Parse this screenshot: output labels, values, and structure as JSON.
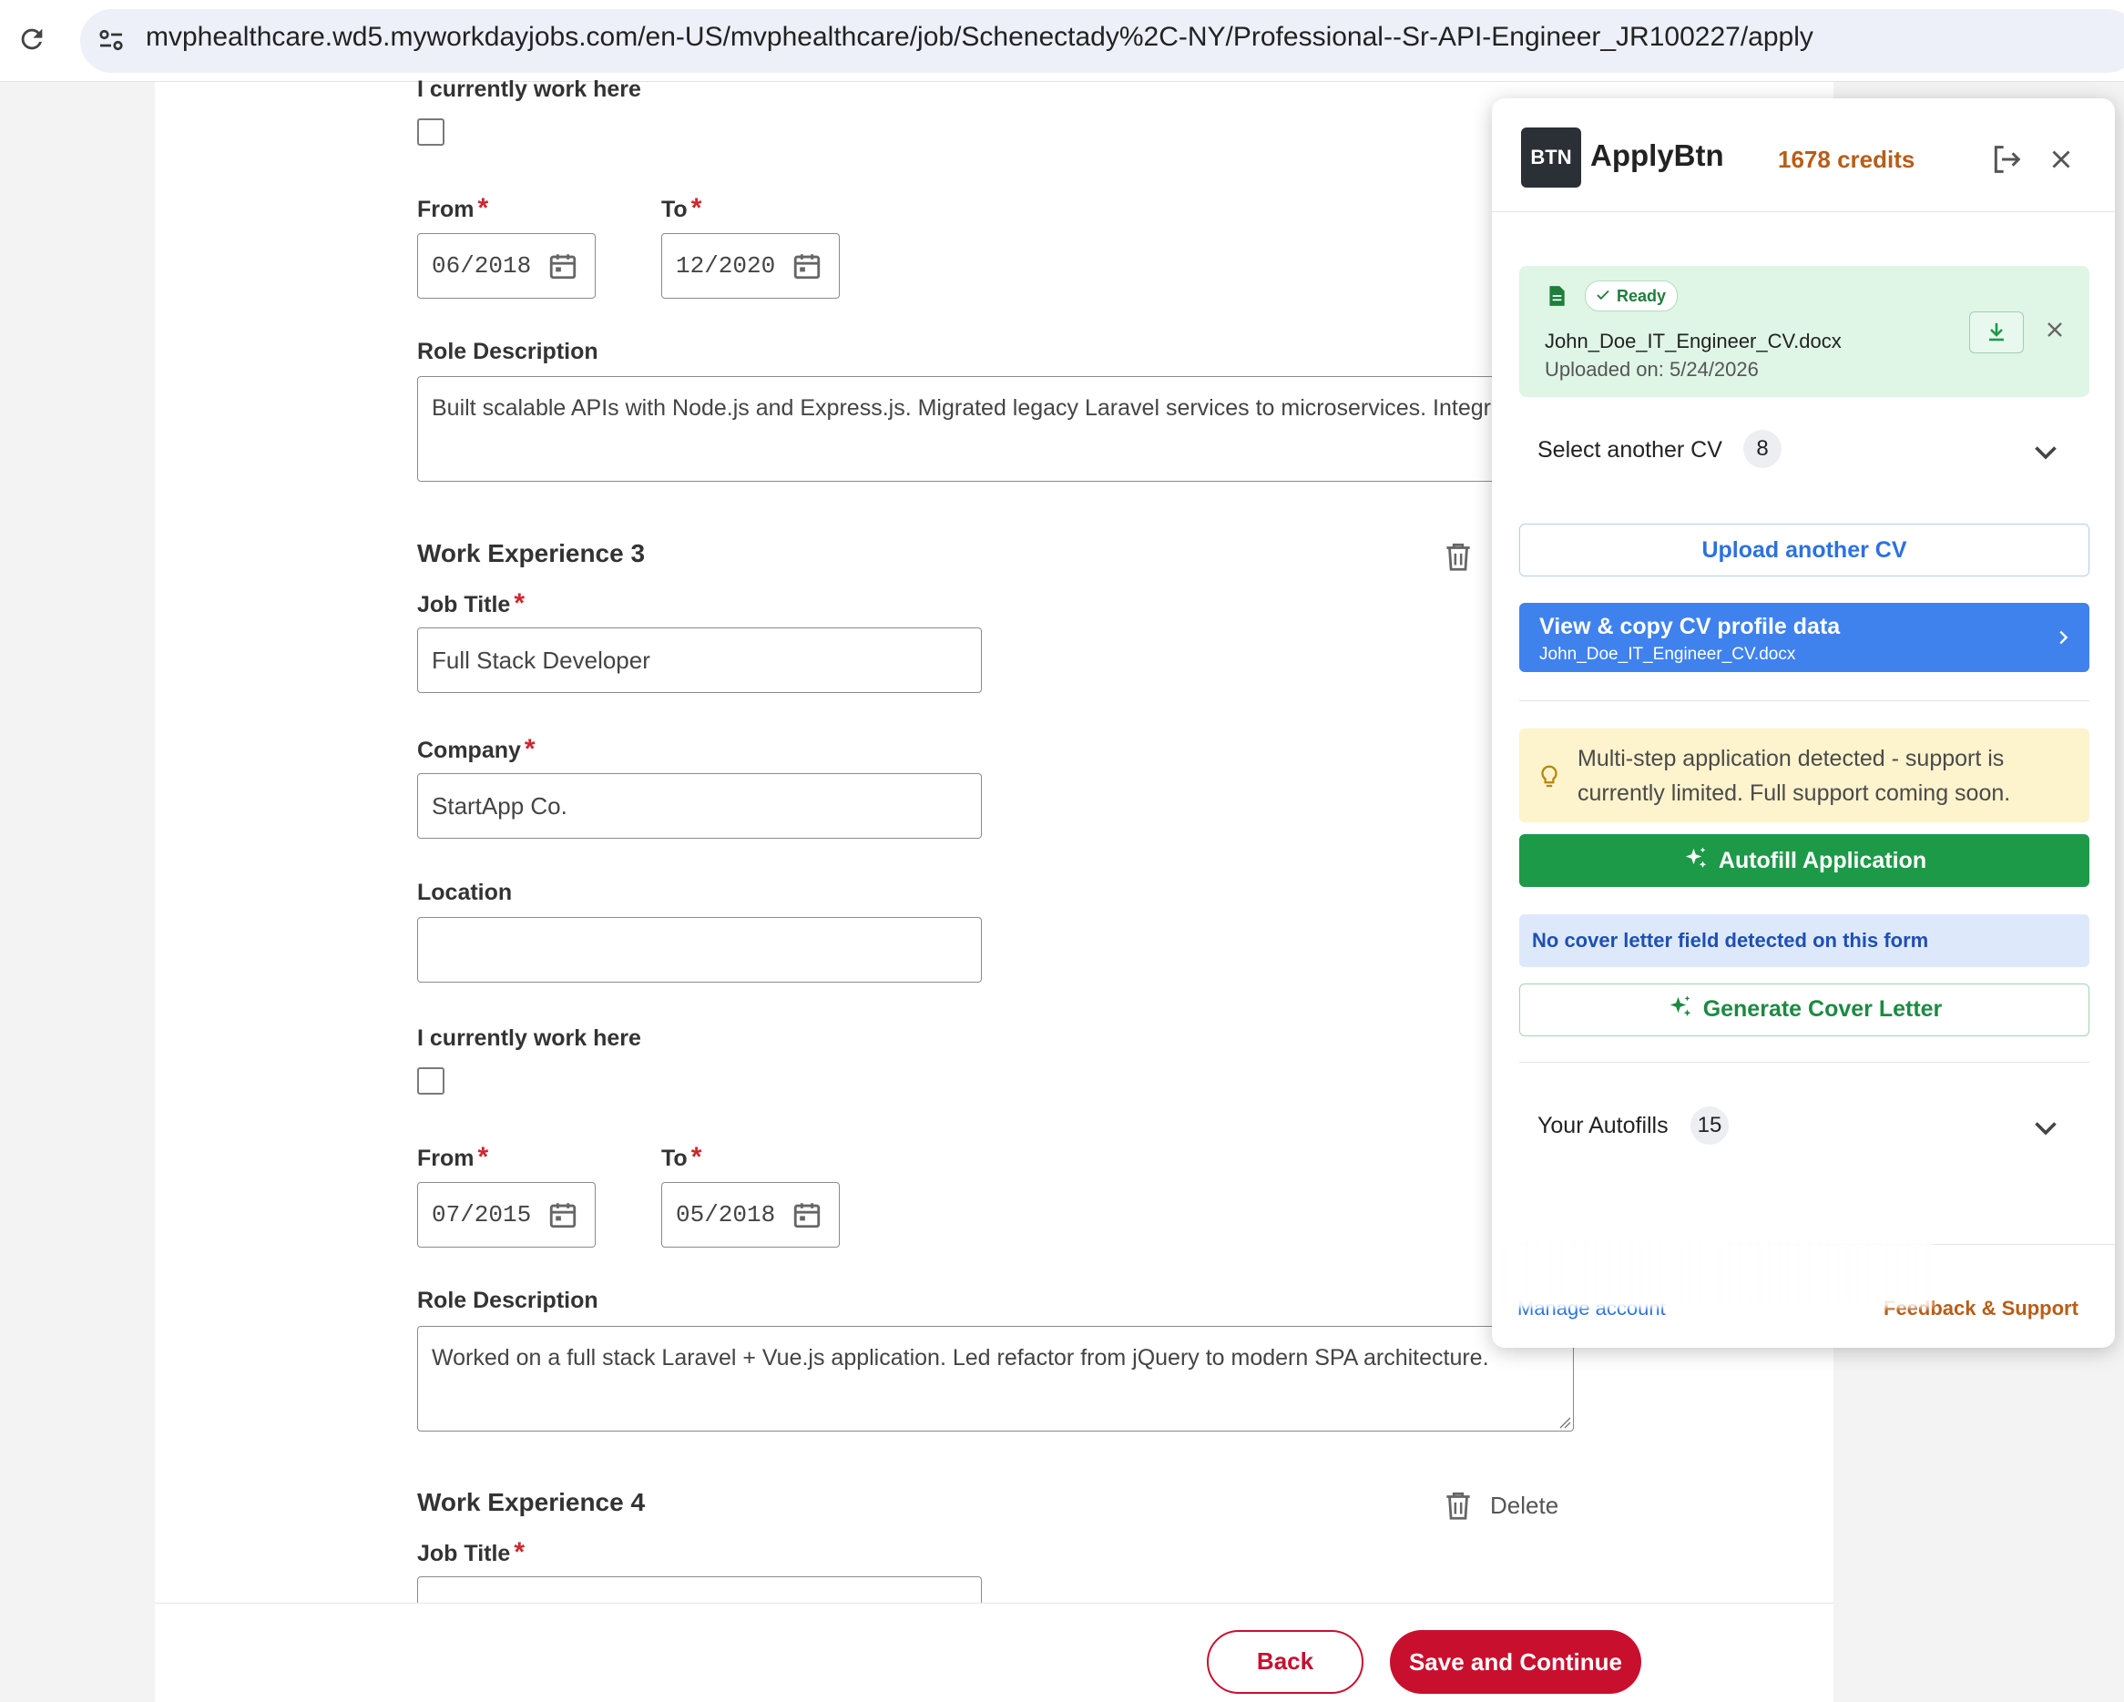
{
  "browser": {
    "url": "mvphealthcare.wd5.myworkdayjobs.com/en-US/mvphealthcare/job/Schenectady%2C-NY/Professional--Sr-API-Engineer_JR100227/apply"
  },
  "form": {
    "exp2": {
      "currently_label": "I currently work here",
      "from_label": "From",
      "to_label": "To",
      "from_value": "06/2018",
      "to_value": "12/2020",
      "role_label": "Role Description",
      "role_value": "Built scalable APIs with Node.js and Express.js. Migrated legacy Laravel services to microservices. Integrated CI pipelines."
    },
    "exp3": {
      "heading": "Work Experience 3",
      "job_title_label": "Job Title",
      "job_title_value": "Full Stack Developer",
      "company_label": "Company",
      "company_value": "StartApp Co.",
      "location_label": "Location",
      "location_value": "",
      "currently_label": "I currently work here",
      "from_label": "From",
      "to_label": "To",
      "from_value": "07/2015",
      "to_value": "05/2018",
      "role_label": "Role Description",
      "role_value": "Worked on a full stack Laravel + Vue.js application. Led refactor from jQuery to modern SPA architecture."
    },
    "exp4": {
      "heading": "Work Experience 4",
      "delete_label": "Delete",
      "job_title_label": "Job Title"
    },
    "required_mark": "*",
    "back_label": "Back",
    "save_label": "Save and Continue"
  },
  "extension": {
    "logo_text": "BTN",
    "brand": "ApplyBtn",
    "credits": "1678 credits",
    "cv": {
      "status": "Ready",
      "filename": "John_Doe_IT_Engineer_CV.docx",
      "uploaded": "Uploaded on: 5/24/2026"
    },
    "select_cv_label": "Select another CV",
    "select_cv_count": "8",
    "upload_label": "Upload another CV",
    "view_label": "View & copy CV profile data",
    "view_sub": "John_Doe_IT_Engineer_CV.docx",
    "notice": "Multi-step application detected - support is currently limited. Full support coming soon.",
    "autofill_label": "Autofill Application",
    "no_cover_info": "No cover letter field detected on this form",
    "cover_label": "Generate Cover Letter",
    "your_autofills_label": "Your Autofills",
    "your_autofills_count": "15",
    "manage_label": "Manage account",
    "feedback_label": "Feedback & Support"
  },
  "colors": {
    "brand_red": "#c8102e",
    "primary_blue": "#3f82ee",
    "success_green": "#1c9a48",
    "credits_orange": "#b85d17"
  }
}
